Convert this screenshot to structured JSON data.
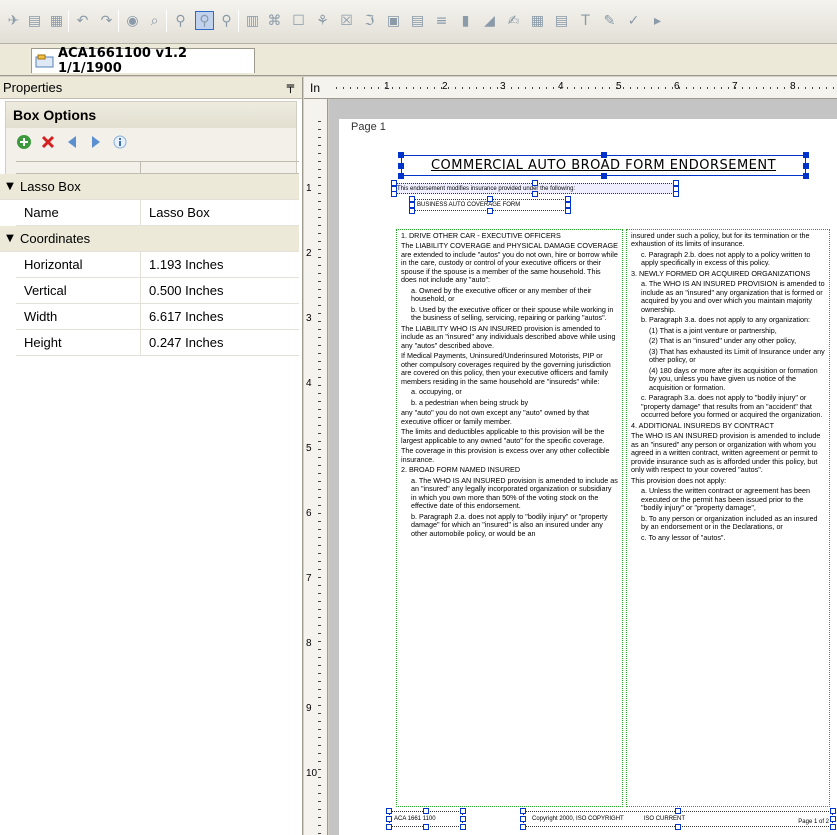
{
  "toolbar": {
    "icons": [
      "pointer-icon",
      "new-icon",
      "copy-icon",
      "undo-icon",
      "redo-icon",
      "help-icon",
      "zoom-icon",
      "lasso-icon",
      "lasso-text-icon",
      "lasso-check-icon",
      "barcode-icon",
      "freeform-icon",
      "rectangle-icon",
      "shapes-icon",
      "checkbox-icon",
      "text-icon",
      "image-icon",
      "table-icon",
      "list-icon",
      "page-icon",
      "line-icon",
      "signature-icon",
      "calendar-icon",
      "doc-icon",
      "text-tool-icon",
      "edit-icon",
      "spell-icon",
      "export-icon"
    ]
  },
  "document_tab": {
    "label": "ACA1661100 v1.2 1/1/1900"
  },
  "properties": {
    "header": "Properties",
    "pin": "ᵖ",
    "box_options_title": "Box Options",
    "grid": {
      "lasso_category": "Lasso Box",
      "name_label": "Name",
      "name_value": "Lasso Box",
      "coordinates_category": "Coordinates",
      "horizontal_label": "Horizontal",
      "horizontal_value": "1.193 Inches",
      "vertical_label": "Vertical",
      "vertical_value": "0.500 Inches",
      "width_label": "Width",
      "width_value": "6.617 Inches",
      "height_label": "Height",
      "height_value": "0.247 Inches"
    }
  },
  "ruler": {
    "unit": "In",
    "top_numbers": [
      "1",
      "2",
      "3",
      "4",
      "5",
      "6",
      "7",
      "8"
    ],
    "left_numbers": [
      "1",
      "2",
      "3",
      "4",
      "5",
      "6",
      "7",
      "8",
      "9",
      "10"
    ]
  },
  "page": {
    "label": "Page 1",
    "title": "COMMERCIAL AUTO BROAD FORM ENDORSEMENT",
    "subtitle1": "This endorsement modifies insurance provided under the following:",
    "subtitle2": "BUSINESS AUTO COVERAGE FORM",
    "left_column": [
      "1. DRIVE OTHER CAR - EXECUTIVE OFFICERS",
      "The LIABILITY COVERAGE and PHYSICAL DAMAGE COVERAGE are extended to include \"autos\" you do not own, hire or borrow while in the care, custody or control of your executive officers or their spouse if the spouse is a member of the same household. This does not include any \"auto\":",
      "a. Owned by the executive officer or any member of their household, or",
      "b. Used by the executive officer or their spouse while working in the business of selling, servicing, repairing or parking \"autos\".",
      "The LIABILITY WHO IS AN INSURED provision is amended to include as an \"insured\" any individuals described above while using any \"autos\" described above.",
      "If Medical Payments, Uninsured/Underinsured Motorists, PIP or other compulsory coverages required by the governing jurisdiction are covered on this policy, then your executive officers and family members residing in the same household are \"insureds\" while:",
      "a. occupying, or",
      "b. a pedestrian when being struck by",
      "any \"auto\" you do not own except any \"auto\" owned by that executive officer or family member.",
      "The limits and deductibles applicable to this provision will be the largest applicable to any owned \"auto\" for the specific coverage.",
      "The coverage in this provision is excess over any other collectible insurance.",
      "2. BROAD FORM NAMED INSURED",
      "a. The WHO IS AN INSURED provision is amended to include as an \"insured\" any legally incorporated organization or subsidiary in which you own more than 50% of the voting stock on the effective date of this endorsement.",
      "b. Paragraph 2.a. does not apply to \"bodily injury\" or \"property damage\" for which an \"insured\" is also an insured under any other automobile policy, or would be an"
    ],
    "right_column": [
      "insured under such a policy, but for its termination or the exhaustion of its limits of insurance.",
      "c. Paragraph 2.b. does not apply to a policy written to apply specifically in excess of this policy.",
      "3. NEWLY FORMED OR ACQUIRED ORGANIZATIONS",
      "a. The WHO IS AN INSURED PROVISION is amended to include as an \"insured\" any organization that is formed or acquired by you and over which you maintain majority ownership.",
      "b. Paragraph 3.a. does not apply to any organization:",
      "(1) That is a joint venture or partnership,",
      "(2) That is an \"insured\" under any other policy,",
      "(3) That has exhausted its Limit of Insurance under any other policy, or",
      "(4) 180 days or more after its acquisition or formation by you, unless you have given us notice of the acquisition or formation.",
      "c. Paragraph 3.a. does not apply to \"bodily injury\" or \"property damage\" that results from an \"accident\" that occurred before you formed or acquired the organization.",
      "4. ADDITIONAL INSUREDS BY CONTRACT",
      "The WHO IS AN INSURED provision is amended to include as an \"insured\" any person or organization with whom you agreed in a written contract, written agreement or permit to provide insurance such as is afforded under this policy, but only with respect to your covered \"autos\".",
      "This provision does not apply:",
      "a. Unless the written contract or agreement has been executed or the permit has been issued prior to the \"bodily injury\" or \"property damage\",",
      "b. To any person or organization included as an insured by an endorsement or in the Declarations, or",
      "c. To any lessor of \"autos\"."
    ],
    "footer_left": "ACA 1661 1100",
    "footer_mid": "Copyright 2000, ISO COPYRIGHT",
    "footer_mid2": "ISO CURRENT",
    "footer_right": "Page 1 of 2"
  }
}
